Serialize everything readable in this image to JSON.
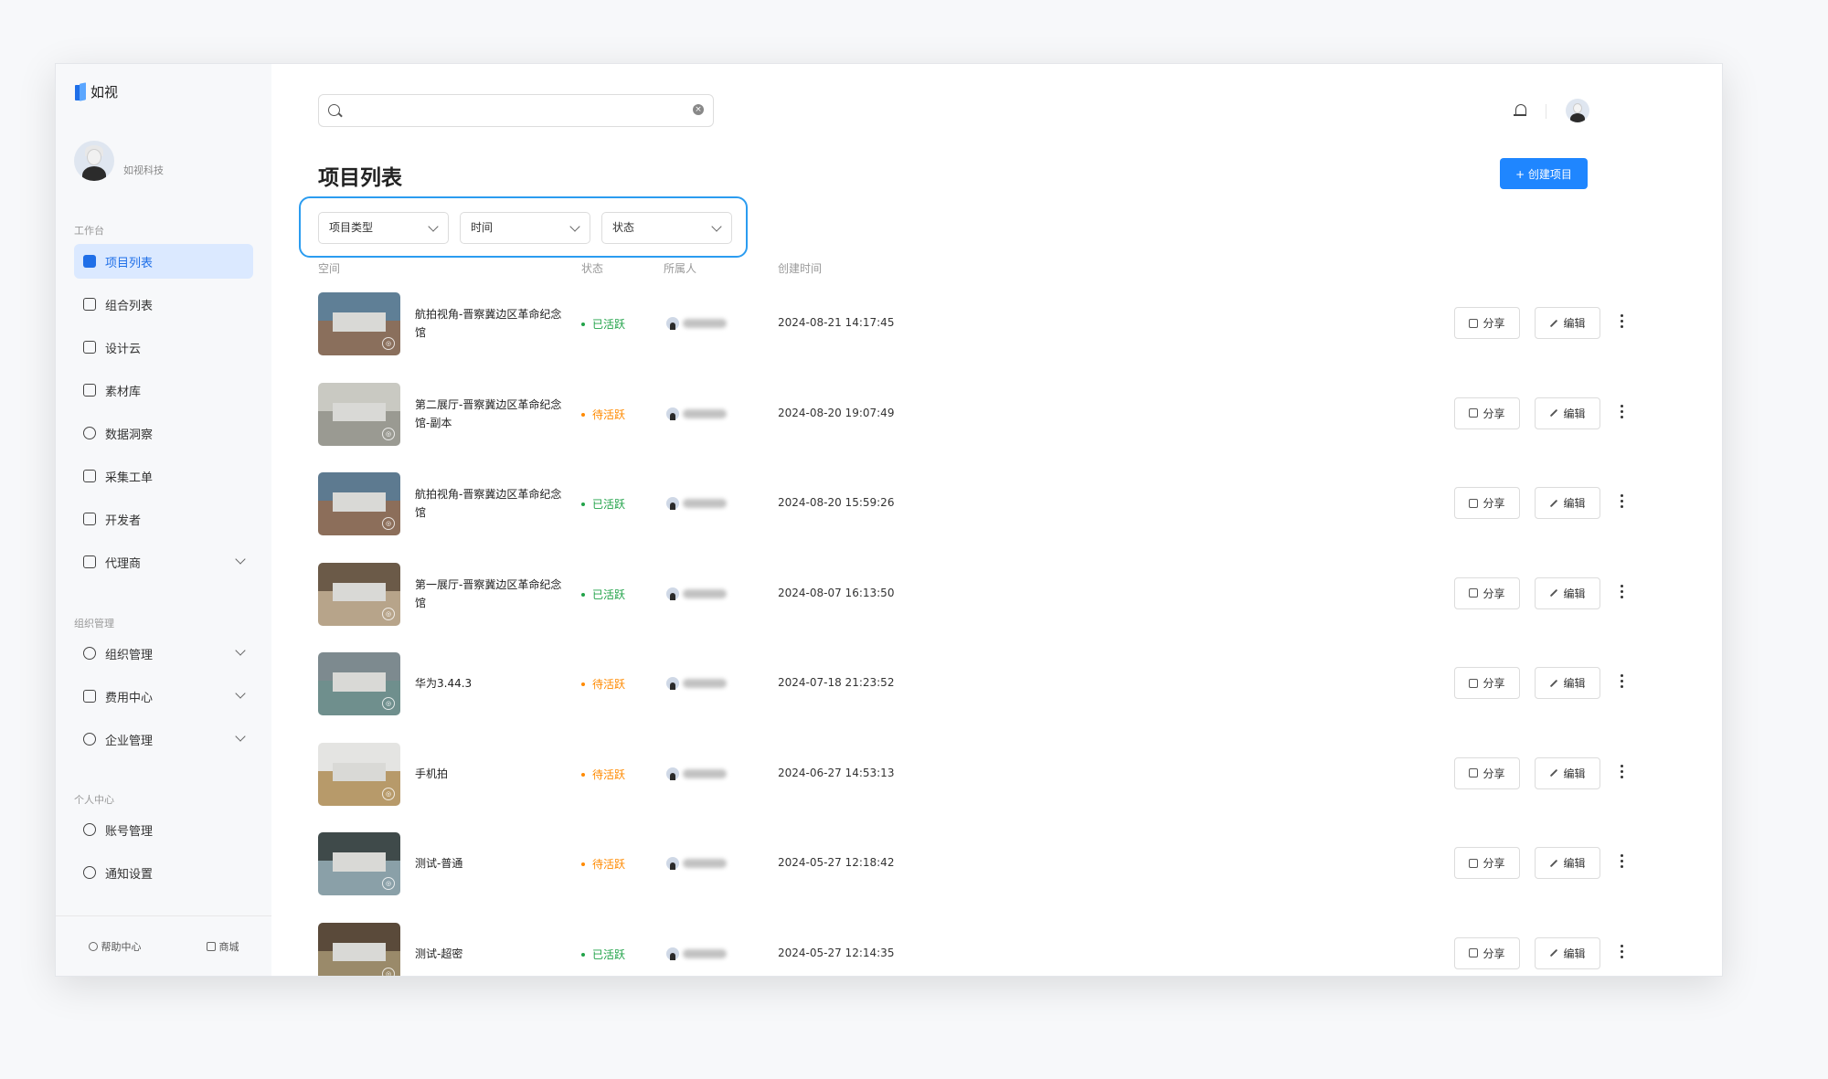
{
  "app": {
    "name": "如视",
    "company": "如视科技"
  },
  "sidebar": {
    "sections": [
      {
        "label": "工作台"
      },
      {
        "label": "组织管理"
      },
      {
        "label": "个人中心"
      }
    ],
    "items": [
      {
        "label": "项目列表",
        "icon": "vr-icon",
        "active": true
      },
      {
        "label": "组合列表",
        "icon": "layers-icon"
      },
      {
        "label": "设计云",
        "icon": "monitor-icon"
      },
      {
        "label": "素材库",
        "icon": "folder-icon"
      },
      {
        "label": "数据洞察",
        "icon": "chart-pie-icon"
      },
      {
        "label": "采集工单",
        "icon": "document-icon"
      },
      {
        "label": "开发者",
        "icon": "code-icon"
      },
      {
        "label": "代理商",
        "icon": "briefcase-icon",
        "expandable": true
      },
      {
        "label": "组织管理",
        "icon": "group-icon",
        "expandable": true
      },
      {
        "label": "费用中心",
        "icon": "wallet-icon",
        "expandable": true
      },
      {
        "label": "企业管理",
        "icon": "diamond-icon",
        "expandable": true
      },
      {
        "label": "账号管理",
        "icon": "user-icon"
      },
      {
        "label": "通知设置",
        "icon": "bell-icon"
      }
    ],
    "footer": {
      "help": "帮助中心",
      "shop": "商城"
    }
  },
  "search": {
    "value": "",
    "placeholder": ""
  },
  "main": {
    "title": "项目列表",
    "create_button": "+ 创建项目",
    "filters": [
      "项目类型",
      "时间",
      "状态"
    ],
    "columns": [
      "空间",
      "状态",
      "所属人",
      "创建时间"
    ],
    "actions": {
      "share": "分享",
      "edit": "编辑"
    }
  },
  "colors": {
    "accent": "#1f86ff",
    "active_status": "#22a34a",
    "pending_status": "#ff8a00",
    "highlight": "#2b9cf0"
  },
  "rows": [
    {
      "name": "航拍视角-晋察冀边区革命纪念馆",
      "status": "已活跃",
      "status_color": "#22a34a",
      "created": "2024-08-21 14:17:45"
    },
    {
      "name": "第二展厅-晋察冀边区革命纪念馆-副本",
      "status": "待活跃",
      "status_color": "#ff8a00",
      "created": "2024-08-20 19:07:49"
    },
    {
      "name": "航拍视角-晋察冀边区革命纪念馆",
      "status": "已活跃",
      "status_color": "#22a34a",
      "created": "2024-08-20 15:59:26"
    },
    {
      "name": "第一展厅-晋察冀边区革命纪念馆",
      "status": "已活跃",
      "status_color": "#22a34a",
      "created": "2024-08-07 16:13:50"
    },
    {
      "name": "华为3.44.3",
      "status": "待活跃",
      "status_color": "#ff8a00",
      "created": "2024-07-18 21:23:52"
    },
    {
      "name": "手机拍",
      "status": "待活跃",
      "status_color": "#ff8a00",
      "created": "2024-06-27 14:53:13"
    },
    {
      "name": "测试-普通",
      "status": "待活跃",
      "status_color": "#ff8a00",
      "created": "2024-05-27 12:18:42"
    },
    {
      "name": "测试-超密",
      "status": "已活跃",
      "status_color": "#22a34a",
      "created": "2024-05-27 12:14:35"
    }
  ]
}
